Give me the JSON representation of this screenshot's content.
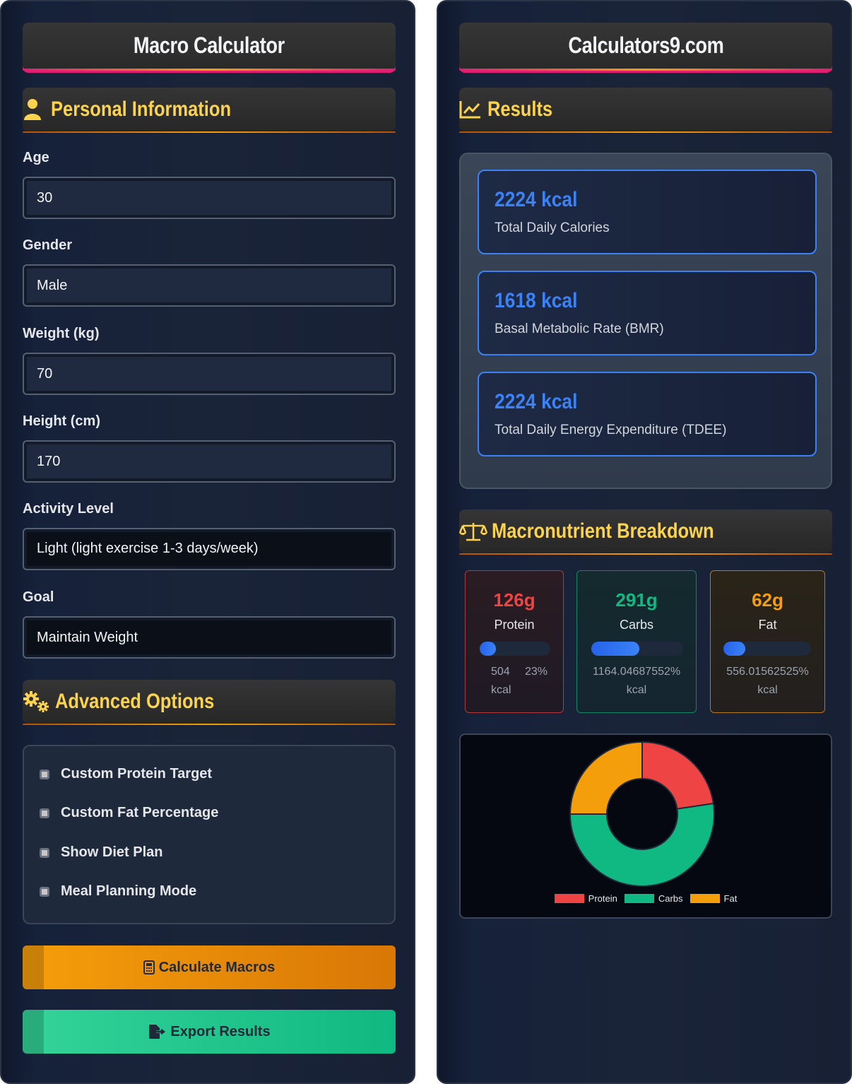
{
  "left": {
    "title": "Macro Calculator",
    "personal_header": "Personal Information",
    "fields": {
      "age": {
        "label": "Age",
        "value": "30"
      },
      "gender": {
        "label": "Gender",
        "value": "Male"
      },
      "weight": {
        "label": "Weight (kg)",
        "value": "70"
      },
      "height": {
        "label": "Height (cm)",
        "value": "170"
      },
      "activity": {
        "label": "Activity Level",
        "value": "Light (light exercise 1-3 days/week)"
      },
      "goal": {
        "label": "Goal",
        "value": "Maintain Weight"
      }
    },
    "advanced_header": "Advanced Options",
    "advanced_options": [
      "Custom Protein Target",
      "Custom Fat Percentage",
      "Show Diet Plan",
      "Meal Planning Mode"
    ],
    "calculate_label": "Calculate Macros",
    "export_label": "Export Results"
  },
  "right": {
    "title": "Calculators9.com",
    "results_header": "Results",
    "results": [
      {
        "value": "2224 kcal",
        "label": "Total Daily Calories"
      },
      {
        "value": "1618 kcal",
        "label": "Basal Metabolic Rate (BMR)"
      },
      {
        "value": "2224 kcal",
        "label": "Total Daily Energy Expenditure (TDEE)"
      }
    ],
    "macro_header": "Macronutrient Breakdown",
    "macros": [
      {
        "grams": "126g",
        "name": "Protein",
        "kcal": "504",
        "pct": "23%",
        "unit": "kcal",
        "bar_fraction": 0.23,
        "color": "#ef4444"
      },
      {
        "grams": "291g",
        "name": "Carbs",
        "kcal": "1164.04687552%",
        "unit": "kcal",
        "bar_fraction": 0.52,
        "color": "#10b981"
      },
      {
        "grams": "62g",
        "name": "Fat",
        "kcal": "556.01562525%",
        "unit": "kcal",
        "bar_fraction": 0.25,
        "color": "#f59e0b"
      }
    ]
  },
  "chart_data": {
    "type": "pie",
    "categories": [
      "Protein",
      "Carbs",
      "Fat"
    ],
    "values": [
      504,
      1164,
      556
    ],
    "colors": [
      "#ef4444",
      "#10b981",
      "#f59e0b"
    ],
    "legend": "bottom",
    "donut": true
  }
}
